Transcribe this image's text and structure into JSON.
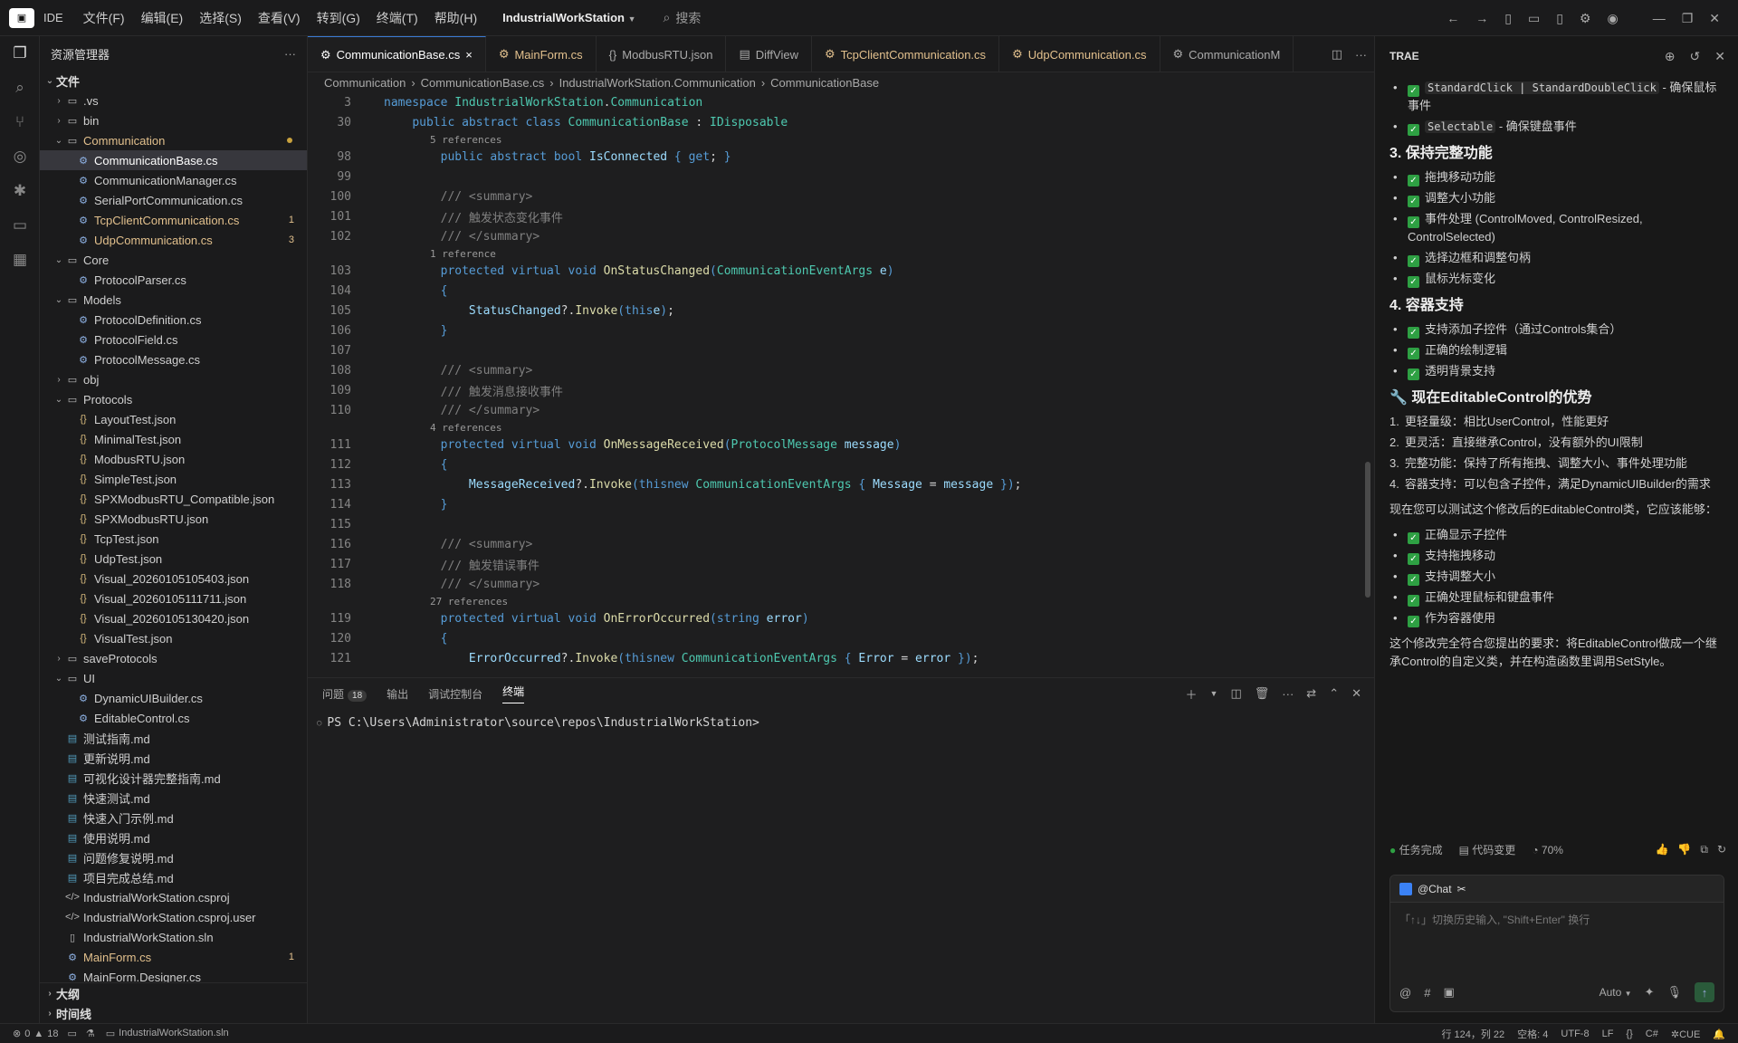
{
  "title": {
    "app_name": "IDE",
    "menus": [
      "文件(F)",
      "编辑(E)",
      "选择(S)",
      "查看(V)",
      "转到(G)",
      "终端(T)",
      "帮助(H)"
    ],
    "project": "IndustrialWorkStation",
    "search_placeholder": "搜索"
  },
  "sidebar": {
    "header": "资源管理器",
    "root": "文件",
    "items": [
      {
        "label": ".vs",
        "kind": "folder",
        "depth": 0,
        "open": false
      },
      {
        "label": "bin",
        "kind": "folder",
        "depth": 0,
        "open": false
      },
      {
        "label": "Communication",
        "kind": "folder",
        "depth": 0,
        "open": true,
        "status": "mod",
        "dot": true
      },
      {
        "label": "CommunicationBase.cs",
        "kind": "cs",
        "depth": 1,
        "selected": true
      },
      {
        "label": "CommunicationManager.cs",
        "kind": "cs",
        "depth": 1
      },
      {
        "label": "SerialPortCommunication.cs",
        "kind": "cs",
        "depth": 1
      },
      {
        "label": "TcpClientCommunication.cs",
        "kind": "cs",
        "depth": 1,
        "status": "mod",
        "badge": "1"
      },
      {
        "label": "UdpCommunication.cs",
        "kind": "cs",
        "depth": 1,
        "status": "mod",
        "badge": "3"
      },
      {
        "label": "Core",
        "kind": "folder",
        "depth": 0,
        "open": true
      },
      {
        "label": "ProtocolParser.cs",
        "kind": "cs",
        "depth": 1
      },
      {
        "label": "Models",
        "kind": "folder",
        "depth": 0,
        "open": true
      },
      {
        "label": "ProtocolDefinition.cs",
        "kind": "cs",
        "depth": 1
      },
      {
        "label": "ProtocolField.cs",
        "kind": "cs",
        "depth": 1
      },
      {
        "label": "ProtocolMessage.cs",
        "kind": "cs",
        "depth": 1
      },
      {
        "label": "obj",
        "kind": "folder",
        "depth": 0,
        "open": false
      },
      {
        "label": "Protocols",
        "kind": "folder",
        "depth": 0,
        "open": true
      },
      {
        "label": "LayoutTest.json",
        "kind": "json",
        "depth": 1
      },
      {
        "label": "MinimalTest.json",
        "kind": "json",
        "depth": 1
      },
      {
        "label": "ModbusRTU.json",
        "kind": "json",
        "depth": 1
      },
      {
        "label": "SimpleTest.json",
        "kind": "json",
        "depth": 1
      },
      {
        "label": "SPXModbusRTU_Compatible.json",
        "kind": "json",
        "depth": 1
      },
      {
        "label": "SPXModbusRTU.json",
        "kind": "json",
        "depth": 1
      },
      {
        "label": "TcpTest.json",
        "kind": "json",
        "depth": 1
      },
      {
        "label": "UdpTest.json",
        "kind": "json",
        "depth": 1
      },
      {
        "label": "Visual_20260105105403.json",
        "kind": "json",
        "depth": 1
      },
      {
        "label": "Visual_20260105111711.json",
        "kind": "json",
        "depth": 1
      },
      {
        "label": "Visual_20260105130420.json",
        "kind": "json",
        "depth": 1
      },
      {
        "label": "VisualTest.json",
        "kind": "json",
        "depth": 1
      },
      {
        "label": "saveProtocols",
        "kind": "folder",
        "depth": 0,
        "open": false
      },
      {
        "label": "UI",
        "kind": "folder",
        "depth": 0,
        "open": true
      },
      {
        "label": "DynamicUIBuilder.cs",
        "kind": "cs",
        "depth": 1
      },
      {
        "label": "EditableControl.cs",
        "kind": "cs",
        "depth": 1
      },
      {
        "label": "测试指南.md",
        "kind": "md",
        "depth": 0
      },
      {
        "label": "更新说明.md",
        "kind": "md",
        "depth": 0
      },
      {
        "label": "可视化设计器完整指南.md",
        "kind": "md",
        "depth": 0
      },
      {
        "label": "快速测试.md",
        "kind": "md",
        "depth": 0
      },
      {
        "label": "快速入门示例.md",
        "kind": "md",
        "depth": 0
      },
      {
        "label": "使用说明.md",
        "kind": "md",
        "depth": 0
      },
      {
        "label": "问题修复说明.md",
        "kind": "md",
        "depth": 0
      },
      {
        "label": "项目完成总结.md",
        "kind": "md",
        "depth": 0
      },
      {
        "label": "IndustrialWorkStation.csproj",
        "kind": "xml",
        "depth": 0
      },
      {
        "label": "IndustrialWorkStation.csproj.user",
        "kind": "xml",
        "depth": 0
      },
      {
        "label": "IndustrialWorkStation.sln",
        "kind": "file",
        "depth": 0
      },
      {
        "label": "MainForm.cs",
        "kind": "cs",
        "depth": 0,
        "status": "mod",
        "badge": "1"
      },
      {
        "label": "MainForm.Designer.cs",
        "kind": "cs",
        "depth": 0
      }
    ],
    "outline_label": "大纲",
    "timeline_label": "时间线"
  },
  "tabs": [
    {
      "label": "CommunicationBase.cs",
      "icon": "cs",
      "active": true,
      "close": "×"
    },
    {
      "label": "MainForm.cs",
      "icon": "cs",
      "status": "mod"
    },
    {
      "label": "ModbusRTU.json",
      "icon": "json"
    },
    {
      "label": "DiffView",
      "icon": "diff"
    },
    {
      "label": "TcpClientCommunication.cs",
      "icon": "cs",
      "status": "mod"
    },
    {
      "label": "UdpCommunication.cs",
      "icon": "cs",
      "status": "mod"
    },
    {
      "label": "CommunicationM",
      "icon": "cs"
    }
  ],
  "breadcrumb": [
    "Communication",
    "CommunicationBase.cs",
    "IndustrialWorkStation.Communication",
    "CommunicationBase"
  ],
  "sticky_lines": [
    {
      "ln": "3",
      "tokens": [
        [
          "kw",
          "namespace "
        ],
        [
          "ty",
          "IndustrialWorkStation"
        ],
        [
          "",
          "."
        ],
        [
          "ty",
          "Communication"
        ]
      ]
    },
    {
      "ln": "30",
      "tokens": [
        [
          "",
          "    "
        ],
        [
          "kw",
          "public abstract class "
        ],
        [
          "ty",
          "CommunicationBase"
        ],
        [
          "",
          " : "
        ],
        [
          "ty",
          "IDisposable"
        ]
      ]
    }
  ],
  "code_lines": [
    {
      "lens": "5 references"
    },
    {
      "ln": "98",
      "tokens": [
        [
          "",
          "        "
        ],
        [
          "kw",
          "public abstract bool "
        ],
        [
          "pr",
          "IsConnected"
        ],
        [
          "",
          " "
        ],
        [
          "br",
          "{ "
        ],
        [
          "kw",
          "get"
        ],
        [
          "",
          ";"
        ],
        [
          "br",
          " }"
        ]
      ]
    },
    {
      "ln": "99",
      "tokens": []
    },
    {
      "ln": "100",
      "tokens": [
        [
          "",
          "        "
        ],
        [
          "cmg",
          "/// <summary>"
        ]
      ]
    },
    {
      "ln": "101",
      "tokens": [
        [
          "",
          "        "
        ],
        [
          "cmg",
          "/// 触发状态变化事件"
        ]
      ]
    },
    {
      "ln": "102",
      "tokens": [
        [
          "",
          "        "
        ],
        [
          "cmg",
          "/// </summary>"
        ]
      ]
    },
    {
      "lens": "1 reference"
    },
    {
      "ln": "103",
      "tokens": [
        [
          "",
          "        "
        ],
        [
          "kw",
          "protected virtual void "
        ],
        [
          "fn",
          "OnStatusChanged"
        ],
        [
          "br",
          "("
        ],
        [
          "ty",
          "CommunicationEventArgs"
        ],
        [
          "",
          " "
        ],
        [
          "pr",
          "e"
        ],
        [
          "br",
          ")"
        ]
      ]
    },
    {
      "ln": "104",
      "tokens": [
        [
          "",
          "        "
        ],
        [
          "br",
          "{"
        ]
      ]
    },
    {
      "ln": "105",
      "tokens": [
        [
          "",
          "            "
        ],
        [
          "pr",
          "StatusChanged"
        ],
        [
          "",
          "?."
        ],
        [
          "fn",
          "Invoke"
        ],
        [
          "br",
          "("
        ],
        [
          "kw",
          "this"
        ],
        [
          ", "
        ],
        [
          "pr",
          "e"
        ],
        [
          "br",
          ")"
        ],
        [
          "",
          ";"
        ]
      ]
    },
    {
      "ln": "106",
      "tokens": [
        [
          "",
          "        "
        ],
        [
          "br",
          "}"
        ]
      ]
    },
    {
      "ln": "107",
      "tokens": []
    },
    {
      "ln": "108",
      "tokens": [
        [
          "",
          "        "
        ],
        [
          "cmg",
          "/// <summary>"
        ]
      ]
    },
    {
      "ln": "109",
      "tokens": [
        [
          "",
          "        "
        ],
        [
          "cmg",
          "/// 触发消息接收事件"
        ]
      ]
    },
    {
      "ln": "110",
      "tokens": [
        [
          "",
          "        "
        ],
        [
          "cmg",
          "/// </summary>"
        ]
      ]
    },
    {
      "lens": "4 references"
    },
    {
      "ln": "111",
      "tokens": [
        [
          "",
          "        "
        ],
        [
          "kw",
          "protected virtual void "
        ],
        [
          "fn",
          "OnMessageReceived"
        ],
        [
          "br",
          "("
        ],
        [
          "ty",
          "ProtocolMessage"
        ],
        [
          "",
          " "
        ],
        [
          "pr",
          "message"
        ],
        [
          "br",
          ")"
        ]
      ]
    },
    {
      "ln": "112",
      "tokens": [
        [
          "",
          "        "
        ],
        [
          "br",
          "{"
        ]
      ]
    },
    {
      "ln": "113",
      "tokens": [
        [
          "",
          "            "
        ],
        [
          "pr",
          "MessageReceived"
        ],
        [
          "",
          "?."
        ],
        [
          "fn",
          "Invoke"
        ],
        [
          "br",
          "("
        ],
        [
          "kw",
          "this"
        ],
        [
          ", "
        ],
        [
          "kw",
          "new "
        ],
        [
          "ty",
          "CommunicationEventArgs"
        ],
        [
          "br",
          " { "
        ],
        [
          "pr",
          "Message"
        ],
        [
          "",
          " = "
        ],
        [
          "pr",
          "message"
        ],
        [
          "br",
          " }"
        ],
        [
          "br",
          ")"
        ],
        [
          "",
          ";"
        ]
      ]
    },
    {
      "ln": "114",
      "tokens": [
        [
          "",
          "        "
        ],
        [
          "br",
          "}"
        ]
      ]
    },
    {
      "ln": "115",
      "tokens": []
    },
    {
      "ln": "116",
      "tokens": [
        [
          "",
          "        "
        ],
        [
          "cmg",
          "/// <summary>"
        ]
      ]
    },
    {
      "ln": "117",
      "tokens": [
        [
          "",
          "        "
        ],
        [
          "cmg",
          "/// 触发错误事件"
        ]
      ]
    },
    {
      "ln": "118",
      "tokens": [
        [
          "",
          "        "
        ],
        [
          "cmg",
          "/// </summary>"
        ]
      ]
    },
    {
      "lens": "27 references"
    },
    {
      "ln": "119",
      "tokens": [
        [
          "",
          "        "
        ],
        [
          "kw",
          "protected virtual void "
        ],
        [
          "fn",
          "OnErrorOccurred"
        ],
        [
          "br",
          "("
        ],
        [
          "kw",
          "string "
        ],
        [
          "pr",
          "error"
        ],
        [
          "br",
          ")"
        ]
      ]
    },
    {
      "ln": "120",
      "tokens": [
        [
          "",
          "        "
        ],
        [
          "br",
          "{"
        ]
      ]
    },
    {
      "ln": "121",
      "tokens": [
        [
          "",
          "            "
        ],
        [
          "pr",
          "ErrorOccurred"
        ],
        [
          "",
          "?."
        ],
        [
          "fn",
          "Invoke"
        ],
        [
          "br",
          "("
        ],
        [
          "kw",
          "this"
        ],
        [
          ", "
        ],
        [
          "kw",
          "new "
        ],
        [
          "ty",
          "CommunicationEventArgs"
        ],
        [
          "br",
          " { "
        ],
        [
          "pr",
          "Error"
        ],
        [
          "",
          " = "
        ],
        [
          "pr",
          "error"
        ],
        [
          "br",
          " }"
        ],
        [
          "br",
          ")"
        ],
        [
          "",
          ";"
        ]
      ]
    }
  ],
  "panel": {
    "tabs": [
      {
        "label": "问题",
        "badge": "18"
      },
      {
        "label": "输出"
      },
      {
        "label": "调试控制台"
      },
      {
        "label": "终端",
        "active": true
      }
    ],
    "terminal_prompt": "PS C:\\Users\\Administrator\\source\\repos\\IndustrialWorkStation>"
  },
  "chat": {
    "title": "TRAE",
    "blocks": [
      {
        "type": "check",
        "code": "StandardClick | StandardDoubleClick",
        "text": " - 确保鼠标事件"
      },
      {
        "type": "check",
        "code": "Selectable",
        "text": " - 确保键盘事件"
      },
      {
        "type": "h3",
        "text": "3. 保持完整功能"
      },
      {
        "type": "check",
        "text": "拖拽移动功能"
      },
      {
        "type": "check",
        "text": "调整大小功能"
      },
      {
        "type": "check",
        "text": "事件处理 (ControlMoved, ControlResized, ControlSelected)"
      },
      {
        "type": "check",
        "text": "选择边框和调整句柄"
      },
      {
        "type": "check",
        "text": "鼠标光标变化"
      },
      {
        "type": "h3",
        "text": "4. 容器支持"
      },
      {
        "type": "check",
        "text": "支持添加子控件（通过Controls集合）"
      },
      {
        "type": "check",
        "text": "正确的绘制逻辑"
      },
      {
        "type": "check",
        "text": "透明背景支持"
      },
      {
        "type": "h3",
        "text": "🔧 现在EditableControl的优势"
      },
      {
        "type": "ol",
        "num": "1.",
        "text": "更轻量级：相比UserControl，性能更好"
      },
      {
        "type": "ol",
        "num": "2.",
        "text": "更灵活：直接继承Control，没有额外的UI限制"
      },
      {
        "type": "ol",
        "num": "3.",
        "text": "完整功能：保持了所有拖拽、调整大小、事件处理功能"
      },
      {
        "type": "ol",
        "num": "4.",
        "text": "容器支持：可以包含子控件，满足DynamicUIBuilder的需求"
      },
      {
        "type": "p",
        "text": "现在您可以测试这个修改后的EditableControl类，它应该能够："
      },
      {
        "type": "check",
        "text": "正确显示子控件"
      },
      {
        "type": "check",
        "text": "支持拖拽移动"
      },
      {
        "type": "check",
        "text": "支持调整大小"
      },
      {
        "type": "check",
        "text": "正确处理鼠标和键盘事件"
      },
      {
        "type": "check",
        "text": "作为容器使用"
      },
      {
        "type": "p",
        "text": "这个修改完全符合您提出的要求：将EditableControl做成一个继承Control的自定义类，并在构造函数里调用SetStyle。"
      }
    ],
    "status_done": "任务完成",
    "status_changes": "代码变更",
    "status_progress": "70%",
    "input_header": "@Chat",
    "input_placeholder": "「↑↓」切换历史输入, \"Shift+Enter\" 换行",
    "mode": "Auto"
  },
  "statusbar": {
    "errors": "0",
    "warnings": "18",
    "solution": "IndustrialWorkStation.sln",
    "position": "行 124，列 22",
    "spaces": "空格: 4",
    "encoding": "UTF-8",
    "eol": "LF",
    "braces": "{}",
    "language": "C#",
    "cue": "CUE"
  }
}
